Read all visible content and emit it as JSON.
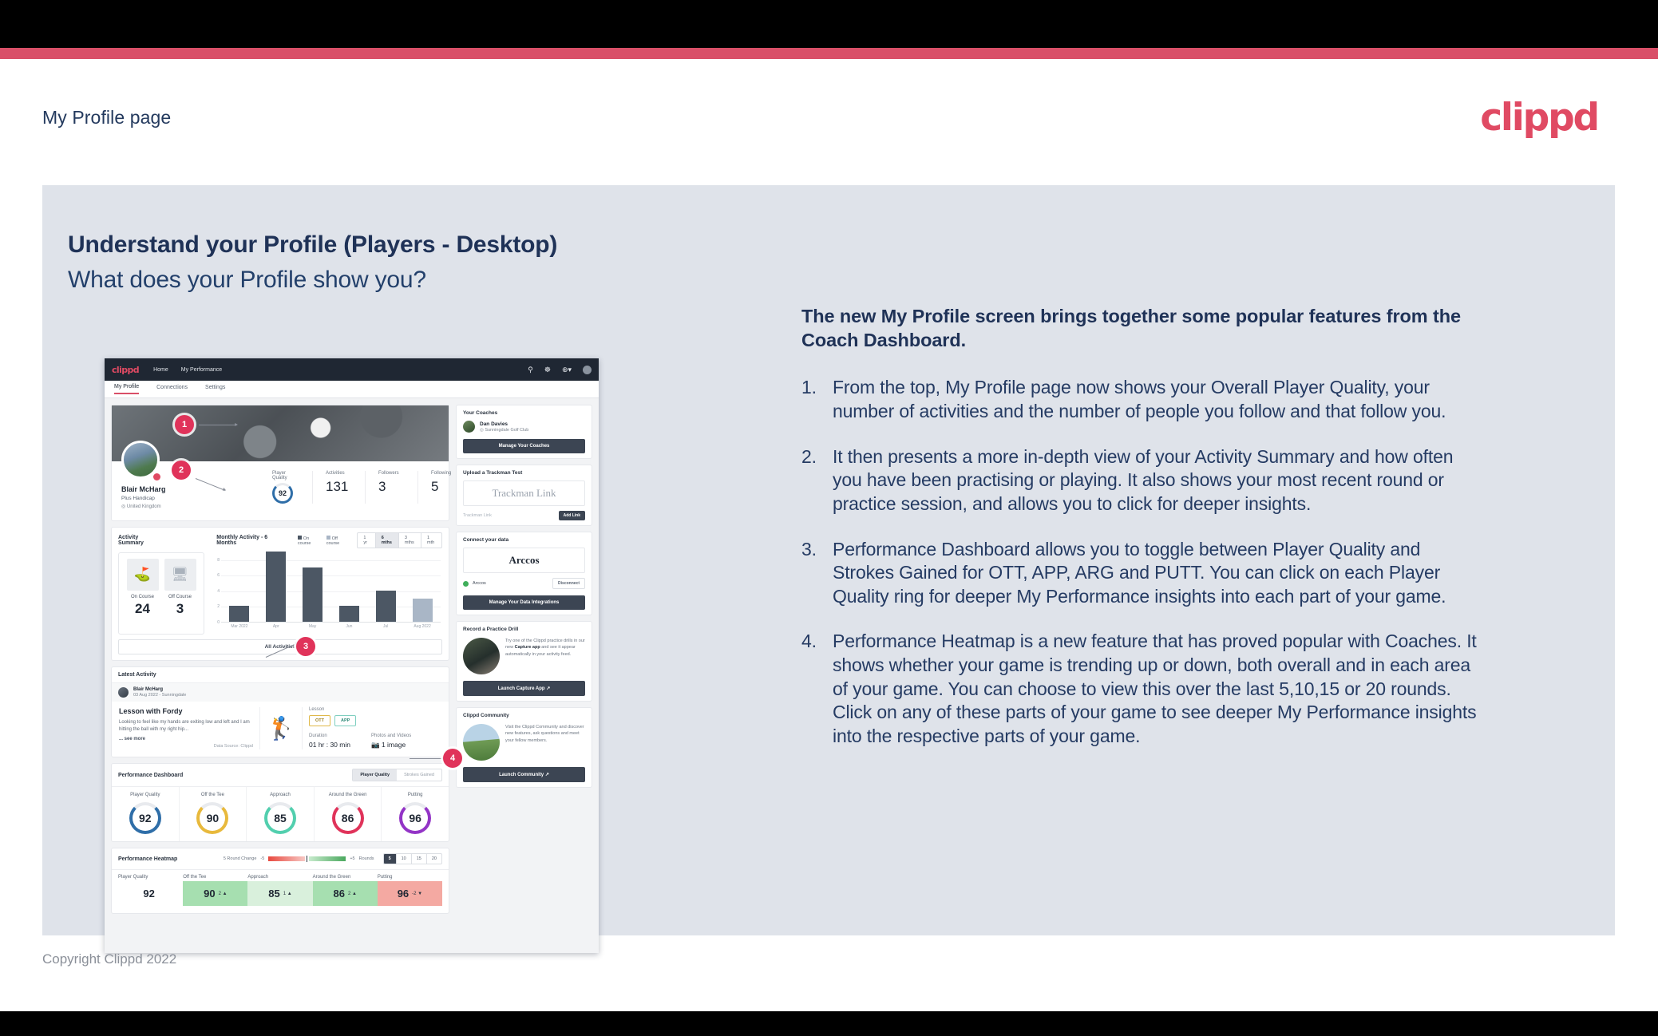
{
  "deck": {
    "header_title": "My Profile page",
    "logo": "clippd",
    "footer": "Copyright Clippd 2022",
    "accent_color": "#d94f68",
    "panel_color": "#dfe3ea"
  },
  "slide": {
    "heading": "Understand your Profile (Players - Desktop)",
    "subheading": "What does your Profile show you?",
    "lede": "The new My Profile screen brings together some popular features from the Coach Dashboard.",
    "points": [
      {
        "num": "1.",
        "text": "From the top, My Profile page now shows your Overall Player Quality, your number of activities and the number of people you follow and that follow you."
      },
      {
        "num": "2.",
        "text": "It then presents a more in-depth view of your Activity Summary and how often you have been practising or playing. It also shows your most recent round or practice session, and allows you to click for deeper insights."
      },
      {
        "num": "3.",
        "text": "Performance Dashboard allows you to toggle between Player Quality and Strokes Gained for OTT, APP, ARG and PUTT. You can click on each Player Quality ring for deeper My Performance insights into each part of your game."
      },
      {
        "num": "4.",
        "text": "Performance Heatmap is a new feature that has proved popular with Coaches. It shows whether your game is trending up or down, both overall and in each area of your game. You can choose to view this over the last 5,10,15 or 20 rounds. Click on any of these parts of your game to see deeper My Performance insights into the respective parts of your game."
      }
    ],
    "callouts": [
      "1",
      "2",
      "3",
      "4"
    ]
  },
  "mockup": {
    "topnav": {
      "brand": "clippd",
      "links": [
        "Home",
        "My Performance"
      ],
      "icons": [
        "search-icon",
        "community-icon",
        "add-icon",
        "avatar-icon"
      ]
    },
    "tabs": [
      {
        "label": "My Profile",
        "active": true
      },
      {
        "label": "Connections",
        "active": false
      },
      {
        "label": "Settings",
        "active": false
      }
    ],
    "profile": {
      "name": "Blair McHarg",
      "handicap": "Plus Handicap",
      "location": "United Kingdom",
      "stats": [
        {
          "label": "Player Quality",
          "value": "92",
          "type": "ring"
        },
        {
          "label": "Activities",
          "value": "131",
          "type": "number"
        },
        {
          "label": "Followers",
          "value": "3",
          "type": "number"
        },
        {
          "label": "Following",
          "value": "5",
          "type": "number"
        }
      ]
    },
    "activity_summary": {
      "title": "Activity Summary",
      "chart_title": "Monthly Activity - 6 Months",
      "legend": [
        "On course",
        "Off course"
      ],
      "ranges": [
        {
          "label": "1 yr",
          "active": false
        },
        {
          "label": "6 mths",
          "active": true
        },
        {
          "label": "3 mths",
          "active": false
        },
        {
          "label": "1 mth",
          "active": false
        }
      ],
      "tiles": [
        {
          "label": "On Course",
          "value": "24",
          "icon": "golf-flag-icon"
        },
        {
          "label": "Off Course",
          "value": "3",
          "icon": "monitor-icon"
        }
      ],
      "all_activities_label": "All Activities"
    },
    "latest_activity": {
      "title": "Latest Activity",
      "user": "Blair McHarg",
      "meta": "03 Aug 2022 - Sunningdale",
      "headline": "Lesson with Fordy",
      "description": "Looking to feel like my hands are exiting low and left and I am hitting the ball with my right hip...",
      "see_more": "... see more",
      "data_source": "Data Source: Clippd",
      "type_label": "Lesson",
      "chips": [
        "OTT",
        "APP"
      ],
      "duration_label": "Duration",
      "duration_value": "01 hr : 30 min",
      "media_label": "Photos and Videos",
      "media_value": "1 image"
    },
    "performance_dashboard": {
      "title": "Performance Dashboard",
      "toggle": [
        {
          "label": "Player Quality",
          "active": true
        },
        {
          "label": "Strokes Gained",
          "active": false
        }
      ],
      "rings": [
        {
          "label": "Player Quality",
          "value": "92",
          "color": "#2f6ea8"
        },
        {
          "label": "Off the Tee",
          "value": "90",
          "color": "#e8b93c"
        },
        {
          "label": "Approach",
          "value": "85",
          "color": "#52cfae"
        },
        {
          "label": "Around the Green",
          "value": "86",
          "color": "#e0335a"
        },
        {
          "label": "Putting",
          "value": "96",
          "color": "#9334c6"
        }
      ]
    },
    "performance_heatmap": {
      "title": "Performance Heatmap",
      "scale_label": "5 Round Change",
      "scale_min": "-5",
      "scale_max": "+5",
      "rounds_label": "Rounds",
      "rounds": [
        {
          "label": "5",
          "active": true
        },
        {
          "label": "10",
          "active": false
        },
        {
          "label": "15",
          "active": false
        },
        {
          "label": "20",
          "active": false
        }
      ],
      "cells": [
        {
          "label": "Player Quality",
          "value": "92",
          "delta": "",
          "bg": "#ffffff"
        },
        {
          "label": "Off the Tee",
          "value": "90",
          "delta": "2 ▲",
          "bg": "#a6dfb0"
        },
        {
          "label": "Approach",
          "value": "85",
          "delta": "1 ▲",
          "bg": "#d9f0dc"
        },
        {
          "label": "Around the Green",
          "value": "86",
          "delta": "2 ▲",
          "bg": "#a6dfb0"
        },
        {
          "label": "Putting",
          "value": "96",
          "delta": "-2 ▼",
          "bg": "#f4a9a2"
        }
      ]
    },
    "sidebar": {
      "coaches": {
        "title": "Your Coaches",
        "coach_name": "Dan Davies",
        "coach_club": "Sunningdale Golf Club",
        "button": "Manage Your Coaches"
      },
      "trackman": {
        "title": "Upload a Trackman Test",
        "logo": "Trackman Link",
        "placeholder": "Trackman Link",
        "button": "Add Link"
      },
      "connect": {
        "title": "Connect your data",
        "logo": "Arccos",
        "source": "Arccos",
        "disconnect": "Disconnect",
        "button": "Manage Your Data Integrations"
      },
      "drill": {
        "title": "Record a Practice Drill",
        "text_1": "Try one of the Clippd practice drills in our new ",
        "text_bold": "Capture app",
        "text_2": " and see it appear automatically in your activity feed.",
        "button": "Launch Capture App"
      },
      "community": {
        "title": "Clippd Community",
        "text": "Visit the Clippd Community and discover new features, ask questions and meet your fellow members.",
        "button": "Launch Community"
      }
    }
  },
  "chart_data": {
    "type": "bar",
    "title": "Monthly Activity - 6 Months",
    "categories": [
      "Mar 2022",
      "Apr",
      "May",
      "Jun",
      "Jul",
      "Aug 2022"
    ],
    "values": [
      2,
      9,
      7,
      2,
      4,
      3
    ],
    "series": [
      {
        "name": "On course",
        "values": [
          2,
          9,
          7,
          2,
          4,
          0
        ],
        "color": "#4c5764"
      },
      {
        "name": "Off course",
        "values": [
          0,
          0,
          0,
          0,
          0,
          3
        ],
        "color": "#a9b6c6"
      }
    ],
    "xlabel": "",
    "ylabel": "",
    "ylim": [
      0,
      9
    ],
    "yticks": [
      0,
      2,
      4,
      6,
      8
    ],
    "grid": true,
    "legend": "top"
  }
}
